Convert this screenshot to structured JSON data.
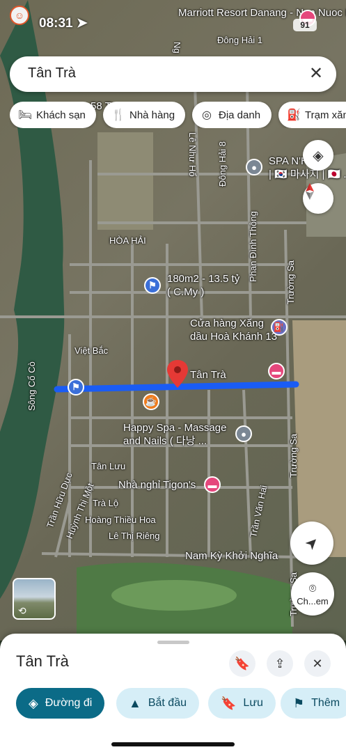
{
  "status_bar": {
    "time": "08:31",
    "battery": "91"
  },
  "search": {
    "query": "Tân Trà",
    "clear_icon": "close-icon"
  },
  "chips": [
    {
      "label": "Khách sạn",
      "icon": "bed-icon"
    },
    {
      "label": "Nhà hàng",
      "icon": "restaurant-icon"
    },
    {
      "label": "Địa danh",
      "icon": "landmark-icon"
    },
    {
      "label": "Trạm xăng",
      "icon": "gas-station-icon"
    }
  ],
  "map": {
    "pois": {
      "marriott": "Marriott Resort Danang\n- Non Nuoc Beach Villas",
      "dong_hai_1": "Đông Hải 1",
      "spa_nhy": "SPA N'HY\n| 🇰🇷 마사지 | 🇯🇵 ..",
      "land_sale": "180m2 - 13.5 tỷ\n( C.My )",
      "gas_station": "Cửa hàng Xăng\ndầu Hoà Khánh 13",
      "selected": "Tân Trà",
      "happy_spa": "Happy Spa - Massage\nand Nails ( 다낭 ...",
      "tigon": "Nhà nghỉ Tigon's",
      "partial_top": "58 Tr",
      "nam_ky": "Nam Kỳ Khởi Nghĩa"
    },
    "streets": {
      "le_nhu_ho": "Lê Như Hổ",
      "dong_hai_8": "Đông Hải 8",
      "phan_dinh_thong": "Phan Đình Thông",
      "truong_sa_1": "Trường Sa",
      "truong_sa_2": "Trường Sa",
      "viet_bac": "Việt Bắc",
      "song_co_co": "Sông Cổ Cò",
      "tan_luu": "Tân Lưu",
      "tran_huu_duc": "Trần Hữu Dực",
      "huynh_thi_mot": "Huỳnh Thị Một",
      "tra_lo": "Trà Lộ",
      "hoang_thieu_hoa": "Hoàng Thiều Hoa",
      "le_thi_rieng": "Lê Thị Riêng",
      "tran_van_hai": "Trần Văn Hai",
      "truong_sa_3": "Trường Sa",
      "hoa_hai": "HÒA HẢI",
      "ng_partial": "Ng"
    },
    "street_view_label": "Ch...em",
    "route_color": "#1a5cf5",
    "marker_color": "#e53935"
  },
  "sheet": {
    "title": "Tân Trà",
    "actions": [
      {
        "label": "Đường đi",
        "icon": "directions-icon"
      },
      {
        "label": "Bắt đầu",
        "icon": "navigation-arrow-icon"
      },
      {
        "label": "Lưu",
        "icon": "bookmark-icon"
      },
      {
        "label": "Thêm",
        "icon": "flag-icon"
      }
    ]
  }
}
